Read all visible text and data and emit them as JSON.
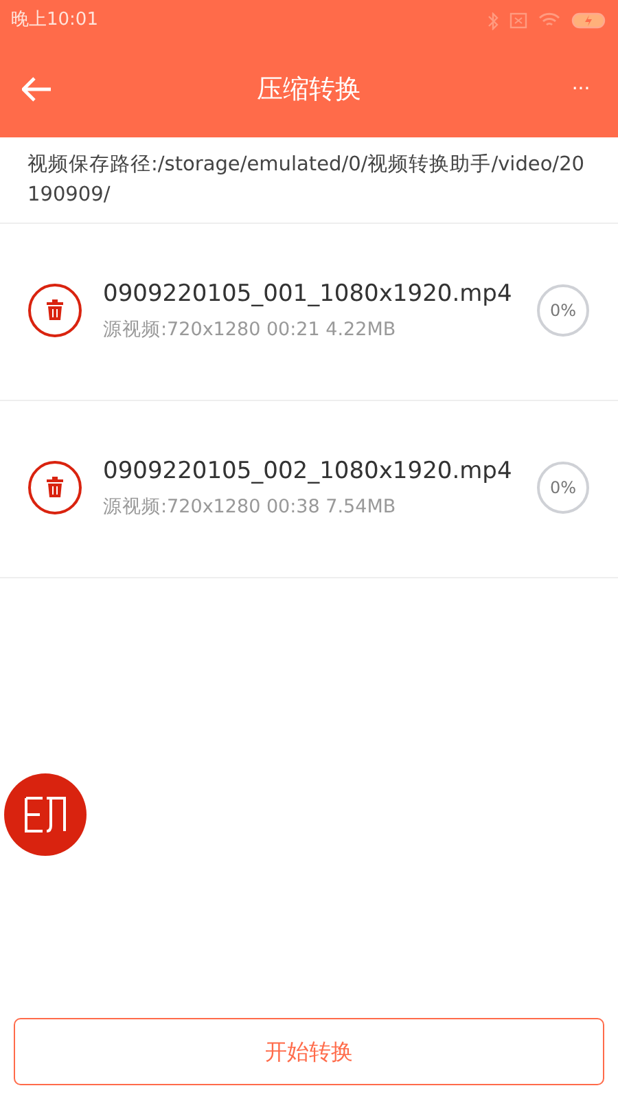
{
  "status_bar": {
    "time": "晚上10:01"
  },
  "toolbar": {
    "title": "压缩转换",
    "more": "···"
  },
  "save_path": "视频保存路径:/storage/emulated/0/视频转换助手/video/20190909/",
  "files": [
    {
      "name": "0909220105_001_1080x1920.mp4",
      "info": "源视频:720x1280 00:21 4.22MB",
      "progress": "0%",
      "level": 0
    },
    {
      "name": "0909220105_002_1080x1920.mp4",
      "info": "源视频:720x1280 00:38 7.54MB",
      "progress": "0%",
      "level": 0
    }
  ],
  "start_button": "开始转换"
}
